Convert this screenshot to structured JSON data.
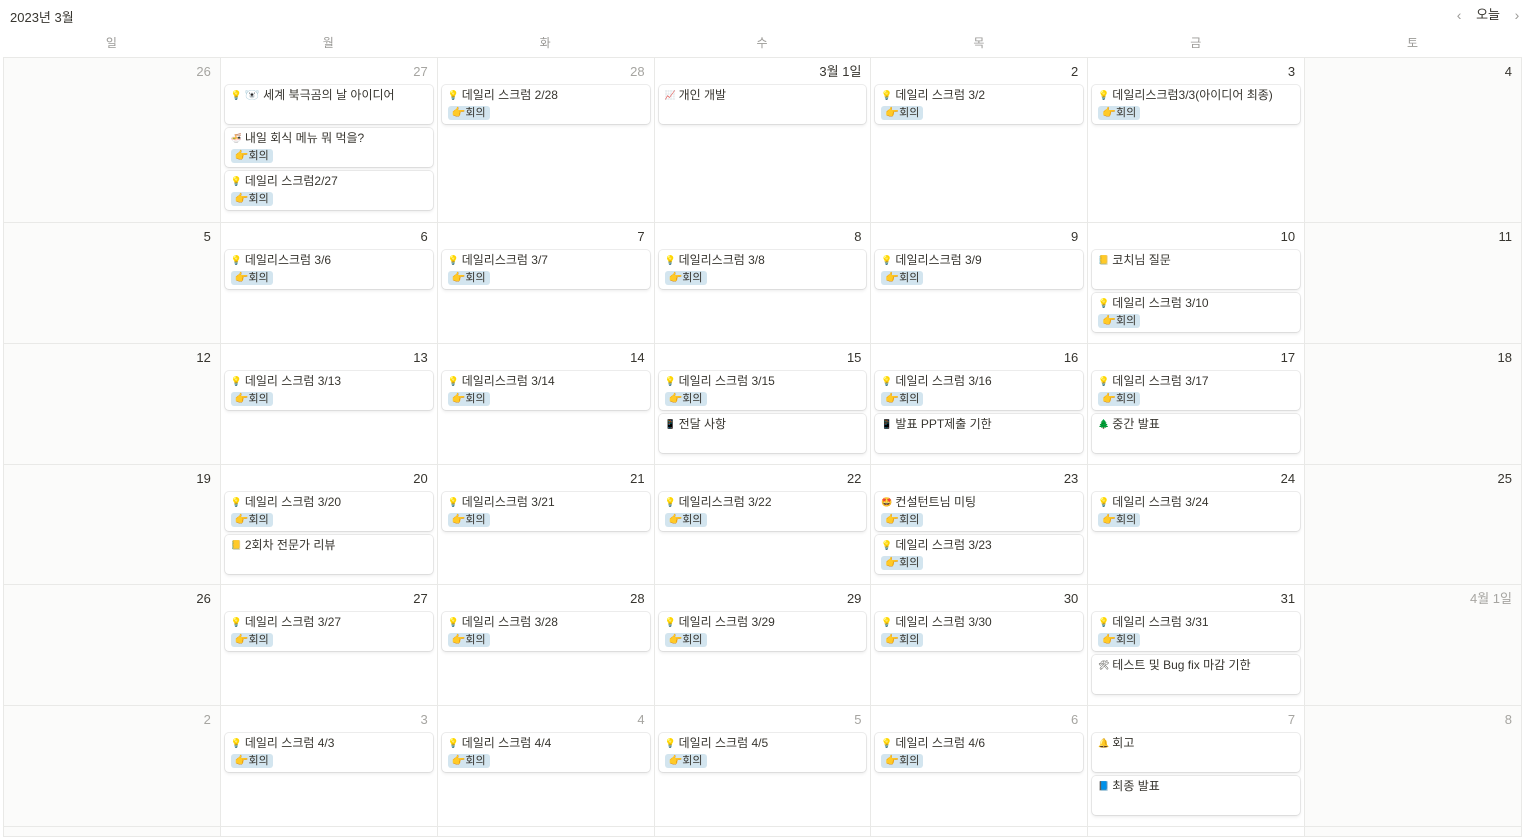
{
  "header": {
    "month_title": "2023년 3월",
    "today_label": "오늘",
    "prev_icon": "‹",
    "next_icon": "›"
  },
  "weekdays": [
    "일",
    "월",
    "화",
    "수",
    "목",
    "금",
    "토"
  ],
  "weeks": [
    {
      "days": [
        {
          "label": "26",
          "muted": true,
          "events": []
        },
        {
          "label": "27",
          "muted": true,
          "events": [
            {
              "icon": "💡",
              "title": "🐻‍❄️ 세계 북극곰의 날 아이디어",
              "tag": ""
            },
            {
              "icon": "🍜",
              "title": "내일 회식 메뉴 뭐 먹을?",
              "tag": "👉회의"
            },
            {
              "icon": "💡",
              "title": "데일리 스크럼2/27",
              "tag": "👉회의"
            }
          ]
        },
        {
          "label": "28",
          "muted": true,
          "events": [
            {
              "icon": "💡",
              "title": "데일리 스크럼 2/28",
              "tag": "👉회의"
            }
          ]
        },
        {
          "label": "3월 1일",
          "muted": false,
          "events": [
            {
              "icon": "📈",
              "title": "개인 개발",
              "tag": ""
            }
          ]
        },
        {
          "label": "2",
          "muted": false,
          "events": [
            {
              "icon": "💡",
              "title": "데일리 스크럼 3/2",
              "tag": "👉회의"
            }
          ]
        },
        {
          "label": "3",
          "muted": false,
          "events": [
            {
              "icon": "💡",
              "title": "데일리스크럼3/3(아이디어 최종)",
              "tag": "👉회의"
            }
          ]
        },
        {
          "label": "4",
          "muted": false,
          "events": []
        }
      ]
    },
    {
      "days": [
        {
          "label": "5",
          "muted": false,
          "events": []
        },
        {
          "label": "6",
          "muted": false,
          "events": [
            {
              "icon": "💡",
              "title": "데일리스크럼 3/6",
              "tag": "👉회의"
            }
          ]
        },
        {
          "label": "7",
          "muted": false,
          "events": [
            {
              "icon": "💡",
              "title": "데일리스크럼 3/7",
              "tag": "👉회의"
            }
          ]
        },
        {
          "label": "8",
          "muted": false,
          "events": [
            {
              "icon": "💡",
              "title": "데일리스크럼 3/8",
              "tag": "👉회의"
            }
          ]
        },
        {
          "label": "9",
          "muted": false,
          "events": [
            {
              "icon": "💡",
              "title": "데일리스크럼 3/9",
              "tag": "👉회의"
            }
          ]
        },
        {
          "label": "10",
          "muted": false,
          "events": [
            {
              "icon": "📒",
              "title": "코치님 질문",
              "tag": ""
            },
            {
              "icon": "💡",
              "title": "데일리 스크럼 3/10",
              "tag": "👉회의"
            }
          ]
        },
        {
          "label": "11",
          "muted": false,
          "events": []
        }
      ]
    },
    {
      "days": [
        {
          "label": "12",
          "muted": false,
          "events": []
        },
        {
          "label": "13",
          "muted": false,
          "events": [
            {
              "icon": "💡",
              "title": "데일리 스크럼 3/13",
              "tag": "👉회의"
            }
          ]
        },
        {
          "label": "14",
          "muted": false,
          "events": [
            {
              "icon": "💡",
              "title": "데일리스크럼 3/14",
              "tag": "👉회의"
            }
          ]
        },
        {
          "label": "15",
          "muted": false,
          "events": [
            {
              "icon": "💡",
              "title": "데일리 스크럼 3/15",
              "tag": "👉회의"
            },
            {
              "icon": "📱",
              "title": "전달 사항",
              "tag": ""
            }
          ]
        },
        {
          "label": "16",
          "muted": false,
          "events": [
            {
              "icon": "💡",
              "title": "데일리 스크럼 3/16",
              "tag": "👉회의"
            },
            {
              "icon": "📱",
              "title": "발표 PPT제출 기한",
              "tag": ""
            }
          ]
        },
        {
          "label": "17",
          "muted": false,
          "events": [
            {
              "icon": "💡",
              "title": "데일리 스크럼 3/17",
              "tag": "👉회의"
            },
            {
              "icon": "🌲",
              "title": "중간 발표",
              "tag": ""
            }
          ]
        },
        {
          "label": "18",
          "muted": false,
          "events": []
        }
      ]
    },
    {
      "days": [
        {
          "label": "19",
          "muted": false,
          "events": []
        },
        {
          "label": "20",
          "muted": false,
          "events": [
            {
              "icon": "💡",
              "title": "데일리 스크럼 3/20",
              "tag": "👉회의"
            },
            {
              "icon": "📒",
              "title": "2회차 전문가 리뷰",
              "tag": ""
            }
          ]
        },
        {
          "label": "21",
          "muted": false,
          "events": [
            {
              "icon": "💡",
              "title": "데일리스크럼 3/21",
              "tag": "👉회의"
            }
          ]
        },
        {
          "label": "22",
          "muted": false,
          "events": [
            {
              "icon": "💡",
              "title": "데일리스크럼 3/22",
              "tag": "👉회의"
            }
          ]
        },
        {
          "label": "23",
          "muted": false,
          "events": [
            {
              "icon": "🤩",
              "title": "컨설턴트님 미팅",
              "tag": "👉회의"
            },
            {
              "icon": "💡",
              "title": "데일리 스크럼 3/23",
              "tag": "👉회의"
            }
          ]
        },
        {
          "label": "24",
          "muted": false,
          "events": [
            {
              "icon": "💡",
              "title": "데일리 스크럼 3/24",
              "tag": "👉회의"
            }
          ]
        },
        {
          "label": "25",
          "muted": false,
          "events": []
        }
      ]
    },
    {
      "days": [
        {
          "label": "26",
          "muted": false,
          "events": []
        },
        {
          "label": "27",
          "muted": false,
          "events": [
            {
              "icon": "💡",
              "title": "데일리 스크럼 3/27",
              "tag": "👉회의"
            }
          ]
        },
        {
          "label": "28",
          "muted": false,
          "events": [
            {
              "icon": "💡",
              "title": "데일리 스크럼 3/28",
              "tag": "👉회의"
            }
          ]
        },
        {
          "label": "29",
          "muted": false,
          "events": [
            {
              "icon": "💡",
              "title": "데일리 스크럼 3/29",
              "tag": "👉회의"
            }
          ]
        },
        {
          "label": "30",
          "muted": false,
          "events": [
            {
              "icon": "💡",
              "title": "데일리 스크럼 3/30",
              "tag": "👉회의"
            }
          ]
        },
        {
          "label": "31",
          "muted": false,
          "events": [
            {
              "icon": "💡",
              "title": "데일리 스크럼 3/31",
              "tag": "👉회의"
            },
            {
              "icon": "🛠",
              "title": "테스트 및 Bug fix 마감 기한",
              "tag": ""
            }
          ]
        },
        {
          "label": "4월 1일",
          "muted": true,
          "events": []
        }
      ]
    },
    {
      "days": [
        {
          "label": "2",
          "muted": true,
          "events": []
        },
        {
          "label": "3",
          "muted": true,
          "events": [
            {
              "icon": "💡",
              "title": "데일리 스크럼 4/3",
              "tag": "👉회의"
            }
          ]
        },
        {
          "label": "4",
          "muted": true,
          "events": [
            {
              "icon": "💡",
              "title": "데일리 스크럼 4/4",
              "tag": "👉회의"
            }
          ]
        },
        {
          "label": "5",
          "muted": true,
          "events": [
            {
              "icon": "💡",
              "title": "데일리 스크럼 4/5",
              "tag": "👉회의"
            }
          ]
        },
        {
          "label": "6",
          "muted": true,
          "events": [
            {
              "icon": "💡",
              "title": "데일리 스크럼 4/6",
              "tag": "👉회의"
            }
          ]
        },
        {
          "label": "7",
          "muted": true,
          "events": [
            {
              "icon": "🔔",
              "title": "회고",
              "tag": ""
            },
            {
              "icon": "📘",
              "title": "최종 발표",
              "tag": ""
            }
          ]
        },
        {
          "label": "8",
          "muted": true,
          "events": []
        }
      ]
    }
  ]
}
